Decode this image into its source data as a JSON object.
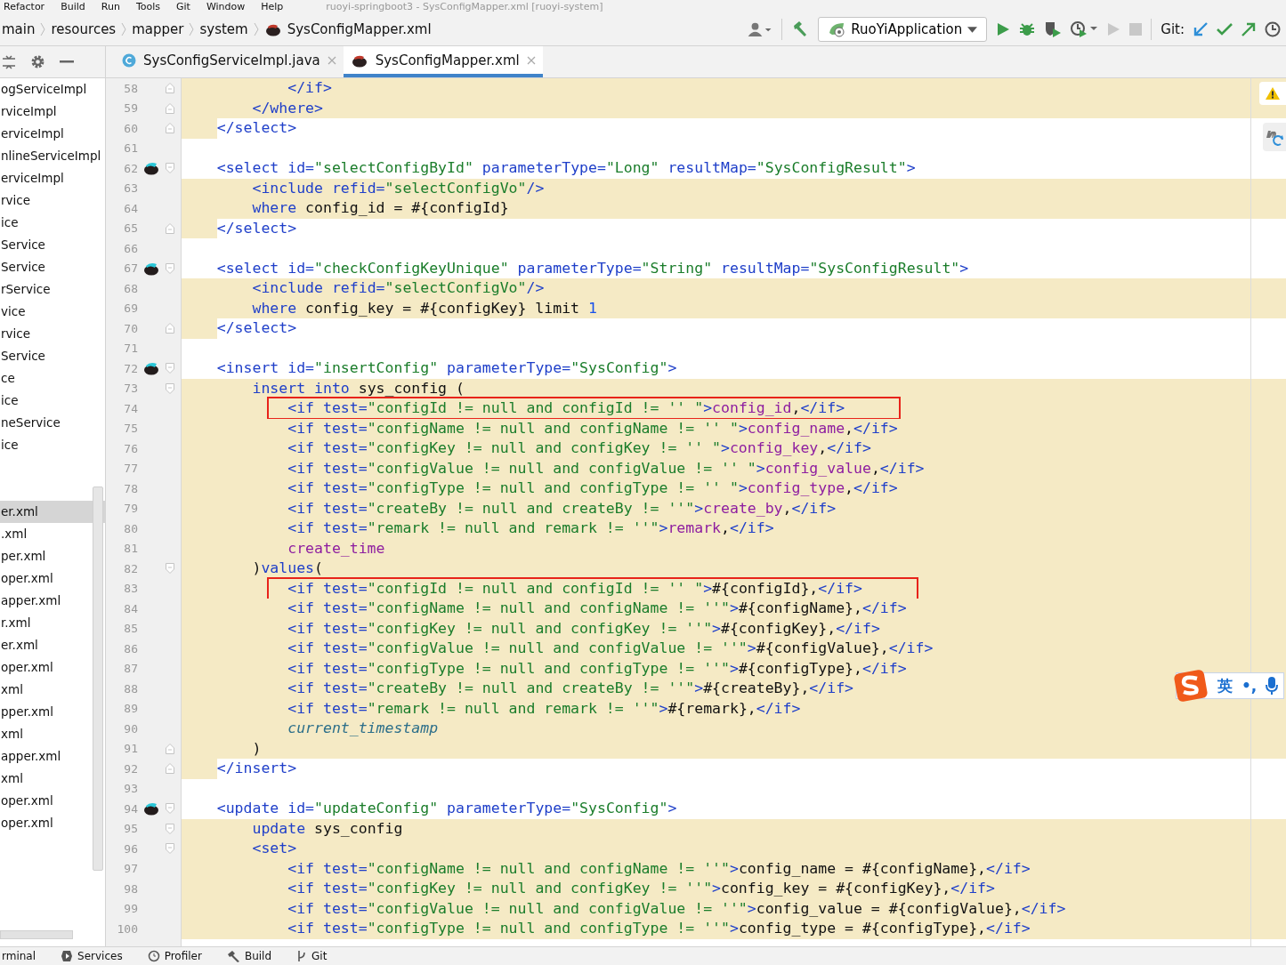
{
  "menu_bar": {
    "items": [
      "Refactor",
      "Build",
      "Run",
      "Tools",
      "Git",
      "Window",
      "Help"
    ],
    "title": "ruoyi-springboot3 - SysConfigMapper.xml [ruoyi-system]"
  },
  "breadcrumbs": [
    "main",
    "resources",
    "mapper",
    "system",
    "SysConfigMapper.xml"
  ],
  "toolbar": {
    "run_config": "RuoYiApplication",
    "git_label": "Git:"
  },
  "editor_tabs": [
    {
      "label": "SysConfigServiceImpl.java",
      "kind": "java",
      "selected": false
    },
    {
      "label": "SysConfigMapper.xml",
      "kind": "xml",
      "selected": true
    }
  ],
  "project_tree": {
    "items": [
      {
        "label": "ogServiceImpl",
        "selected": false
      },
      {
        "label": "rviceImpl",
        "selected": false
      },
      {
        "label": "erviceImpl",
        "selected": false
      },
      {
        "label": "nlineServiceImpl",
        "selected": false
      },
      {
        "label": "erviceImpl",
        "selected": false
      },
      {
        "label": "rvice",
        "selected": false
      },
      {
        "label": "ice",
        "selected": false
      },
      {
        "label": "Service",
        "selected": false
      },
      {
        "label": "Service",
        "selected": false
      },
      {
        "label": "rService",
        "selected": false
      },
      {
        "label": "vice",
        "selected": false
      },
      {
        "label": "rvice",
        "selected": false
      },
      {
        "label": "Service",
        "selected": false
      },
      {
        "label": "ce",
        "selected": false
      },
      {
        "label": "ice",
        "selected": false
      },
      {
        "label": "neService",
        "selected": false
      },
      {
        "label": "ice",
        "selected": false
      }
    ],
    "xml_items": [
      {
        "label": "er.xml",
        "selected": true
      },
      {
        "label": ".xml",
        "selected": false
      },
      {
        "label": "per.xml",
        "selected": false
      },
      {
        "label": "oper.xml",
        "selected": false
      },
      {
        "label": "apper.xml",
        "selected": false
      },
      {
        "label": "r.xml",
        "selected": false
      },
      {
        "label": "er.xml",
        "selected": false
      },
      {
        "label": "oper.xml",
        "selected": false
      },
      {
        "label": "xml",
        "selected": false
      },
      {
        "label": "pper.xml",
        "selected": false
      },
      {
        "label": "xml",
        "selected": false
      },
      {
        "label": "apper.xml",
        "selected": false
      },
      {
        "label": "xml",
        "selected": false
      },
      {
        "label": "oper.xml",
        "selected": false
      },
      {
        "label": "oper.xml",
        "selected": false
      }
    ]
  },
  "code_lines": [
    {
      "number": "58",
      "fold_end": true,
      "highlighted": true,
      "tokens": [
        {
          "kind": "tag",
          "text": "            </if>"
        }
      ]
    },
    {
      "number": "59",
      "fold_end": true,
      "highlighted": true,
      "tokens": [
        {
          "kind": "tag",
          "text": "        </where>"
        }
      ]
    },
    {
      "number": "60",
      "fold_end": true,
      "highlighted": false,
      "indent_highlighted": true,
      "tokens": [
        {
          "kind": "tag",
          "text": "    </select>"
        }
      ]
    },
    {
      "number": "61",
      "highlighted": false
    },
    {
      "number": "62",
      "fold_start": true,
      "bird": true,
      "highlighted": false,
      "tokens": [
        {
          "kind": "tag",
          "text": "    <select"
        },
        {
          "kind": "attr",
          "text": " id="
        },
        {
          "kind": "val",
          "text": "\"selectConfigById\""
        },
        {
          "kind": "attr",
          "text": " parameterType="
        },
        {
          "kind": "val",
          "text": "\"Long\""
        },
        {
          "kind": "attr",
          "text": " resultMap="
        },
        {
          "kind": "val",
          "text": "\"SysConfigResult\""
        },
        {
          "kind": "tag",
          "text": ">"
        }
      ]
    },
    {
      "number": "63",
      "highlighted": true,
      "tokens": [
        {
          "kind": "tag",
          "text": "        <include"
        },
        {
          "kind": "attr",
          "text": " refid="
        },
        {
          "kind": "val",
          "text": "\"selectConfigVo\""
        },
        {
          "kind": "tag",
          "text": "/>"
        }
      ]
    },
    {
      "number": "64",
      "highlighted": true,
      "tokens": [
        {
          "kind": "kw",
          "text": "        where"
        },
        {
          "kind": "plain",
          "text": " config_id = #{configId}"
        }
      ]
    },
    {
      "number": "65",
      "fold_end": true,
      "highlighted": false,
      "indent_highlighted": true,
      "tokens": [
        {
          "kind": "tag",
          "text": "    </select>"
        }
      ]
    },
    {
      "number": "66",
      "highlighted": false
    },
    {
      "number": "67",
      "fold_start": true,
      "bird": true,
      "highlighted": false,
      "tokens": [
        {
          "kind": "tag",
          "text": "    <select"
        },
        {
          "kind": "attr",
          "text": " id="
        },
        {
          "kind": "val",
          "text": "\"checkConfigKeyUnique\""
        },
        {
          "kind": "attr",
          "text": " parameterType="
        },
        {
          "kind": "val",
          "text": "\"String\""
        },
        {
          "kind": "attr",
          "text": " resultMap="
        },
        {
          "kind": "val",
          "text": "\"SysConfigResult\""
        },
        {
          "kind": "tag",
          "text": ">"
        }
      ]
    },
    {
      "number": "68",
      "highlighted": true,
      "tokens": [
        {
          "kind": "tag",
          "text": "        <include"
        },
        {
          "kind": "attr",
          "text": " refid="
        },
        {
          "kind": "val",
          "text": "\"selectConfigVo\""
        },
        {
          "kind": "tag",
          "text": "/>"
        }
      ]
    },
    {
      "number": "69",
      "highlighted": true,
      "tokens": [
        {
          "kind": "kw",
          "text": "        where"
        },
        {
          "kind": "plain",
          "text": " config_key = #{configKey} limit "
        },
        {
          "kind": "num",
          "text": "1"
        }
      ]
    },
    {
      "number": "70",
      "fold_end": true,
      "highlighted": false,
      "indent_highlighted": true,
      "tokens": [
        {
          "kind": "tag",
          "text": "    </select>"
        }
      ]
    },
    {
      "number": "71",
      "highlighted": false
    },
    {
      "number": "72",
      "fold_start": true,
      "bird": true,
      "highlighted": false,
      "tokens": [
        {
          "kind": "tag",
          "text": "    <insert"
        },
        {
          "kind": "attr",
          "text": " id="
        },
        {
          "kind": "val",
          "text": "\"insertConfig\""
        },
        {
          "kind": "attr",
          "text": " parameterType="
        },
        {
          "kind": "val",
          "text": "\"SysConfig\""
        },
        {
          "kind": "tag",
          "text": ">"
        }
      ]
    },
    {
      "number": "73",
      "fold_start": true,
      "highlighted": true,
      "tokens": [
        {
          "kind": "kw",
          "text": "        insert into"
        },
        {
          "kind": "plain",
          "text": " sys_config ("
        }
      ]
    },
    {
      "number": "74",
      "highlighted": true,
      "boxed": true,
      "tokens": [
        {
          "kind": "tag",
          "text": "            <if"
        },
        {
          "kind": "attr",
          "text": " test="
        },
        {
          "kind": "val",
          "text": "\"configId != null and configId != '' \""
        },
        {
          "kind": "tag",
          "text": ">"
        },
        {
          "kind": "field",
          "text": "config_id"
        },
        {
          "kind": "plain",
          "text": ","
        },
        {
          "kind": "tag",
          "text": "</if>"
        }
      ]
    },
    {
      "number": "75",
      "highlighted": true,
      "tokens": [
        {
          "kind": "tag",
          "text": "            <if"
        },
        {
          "kind": "attr",
          "text": " test="
        },
        {
          "kind": "val",
          "text": "\"configName != null and configName != '' \""
        },
        {
          "kind": "tag",
          "text": ">"
        },
        {
          "kind": "field",
          "text": "config_name"
        },
        {
          "kind": "plain",
          "text": ","
        },
        {
          "kind": "tag",
          "text": "</if>"
        }
      ]
    },
    {
      "number": "76",
      "highlighted": true,
      "tokens": [
        {
          "kind": "tag",
          "text": "            <if"
        },
        {
          "kind": "attr",
          "text": " test="
        },
        {
          "kind": "val",
          "text": "\"configKey != null and configKey != '' \""
        },
        {
          "kind": "tag",
          "text": ">"
        },
        {
          "kind": "field",
          "text": "config_key"
        },
        {
          "kind": "plain",
          "text": ","
        },
        {
          "kind": "tag",
          "text": "</if>"
        }
      ]
    },
    {
      "number": "77",
      "highlighted": true,
      "tokens": [
        {
          "kind": "tag",
          "text": "            <if"
        },
        {
          "kind": "attr",
          "text": " test="
        },
        {
          "kind": "val",
          "text": "\"configValue != null and configValue != '' \""
        },
        {
          "kind": "tag",
          "text": ">"
        },
        {
          "kind": "field",
          "text": "config_value"
        },
        {
          "kind": "plain",
          "text": ","
        },
        {
          "kind": "tag",
          "text": "</if>"
        }
      ]
    },
    {
      "number": "78",
      "highlighted": true,
      "tokens": [
        {
          "kind": "tag",
          "text": "            <if"
        },
        {
          "kind": "attr",
          "text": " test="
        },
        {
          "kind": "val",
          "text": "\"configType != null and configType != '' \""
        },
        {
          "kind": "tag",
          "text": ">"
        },
        {
          "kind": "field",
          "text": "config_type"
        },
        {
          "kind": "plain",
          "text": ","
        },
        {
          "kind": "tag",
          "text": "</if>"
        }
      ]
    },
    {
      "number": "79",
      "highlighted": true,
      "tokens": [
        {
          "kind": "tag",
          "text": "            <if"
        },
        {
          "kind": "attr",
          "text": " test="
        },
        {
          "kind": "val",
          "text": "\"createBy != null and createBy != ''\""
        },
        {
          "kind": "tag",
          "text": ">"
        },
        {
          "kind": "field",
          "text": "create_by"
        },
        {
          "kind": "plain",
          "text": ","
        },
        {
          "kind": "tag",
          "text": "</if>"
        }
      ]
    },
    {
      "number": "80",
      "highlighted": true,
      "tokens": [
        {
          "kind": "tag",
          "text": "            <if"
        },
        {
          "kind": "attr",
          "text": " test="
        },
        {
          "kind": "val",
          "text": "\"remark != null and remark != ''\""
        },
        {
          "kind": "tag",
          "text": ">"
        },
        {
          "kind": "field",
          "text": "remark"
        },
        {
          "kind": "plain",
          "text": ","
        },
        {
          "kind": "tag",
          "text": "</if>"
        }
      ]
    },
    {
      "number": "81",
      "highlighted": true,
      "tokens": [
        {
          "kind": "field",
          "text": "            create_time"
        }
      ]
    },
    {
      "number": "82",
      "fold_start": true,
      "highlighted": true,
      "tokens": [
        {
          "kind": "plain",
          "text": "        )"
        },
        {
          "kind": "kw",
          "text": "values"
        },
        {
          "kind": "plain",
          "text": "("
        }
      ]
    },
    {
      "number": "83",
      "highlighted": true,
      "boxed": true,
      "tokens": [
        {
          "kind": "tag",
          "text": "            <if"
        },
        {
          "kind": "attr",
          "text": " test="
        },
        {
          "kind": "val",
          "text": "\"configId != null and configId != '' \""
        },
        {
          "kind": "tag",
          "text": ">"
        },
        {
          "kind": "plain",
          "text": "#{configId},"
        },
        {
          "kind": "tag",
          "text": "</if>"
        }
      ]
    },
    {
      "number": "84",
      "highlighted": true,
      "tokens": [
        {
          "kind": "tag",
          "text": "            <if"
        },
        {
          "kind": "attr",
          "text": " test="
        },
        {
          "kind": "val",
          "text": "\"configName != null and configName != ''\""
        },
        {
          "kind": "tag",
          "text": ">"
        },
        {
          "kind": "plain",
          "text": "#{configName},"
        },
        {
          "kind": "tag",
          "text": "</if>"
        }
      ]
    },
    {
      "number": "85",
      "highlighted": true,
      "tokens": [
        {
          "kind": "tag",
          "text": "            <if"
        },
        {
          "kind": "attr",
          "text": " test="
        },
        {
          "kind": "val",
          "text": "\"configKey != null and configKey != ''\""
        },
        {
          "kind": "tag",
          "text": ">"
        },
        {
          "kind": "plain",
          "text": "#{configKey},"
        },
        {
          "kind": "tag",
          "text": "</if>"
        }
      ]
    },
    {
      "number": "86",
      "highlighted": true,
      "tokens": [
        {
          "kind": "tag",
          "text": "            <if"
        },
        {
          "kind": "attr",
          "text": " test="
        },
        {
          "kind": "val",
          "text": "\"configValue != null and configValue != ''\""
        },
        {
          "kind": "tag",
          "text": ">"
        },
        {
          "kind": "plain",
          "text": "#{configValue},"
        },
        {
          "kind": "tag",
          "text": "</if>"
        }
      ]
    },
    {
      "number": "87",
      "highlighted": true,
      "tokens": [
        {
          "kind": "tag",
          "text": "            <if"
        },
        {
          "kind": "attr",
          "text": " test="
        },
        {
          "kind": "val",
          "text": "\"configType != null and configType != ''\""
        },
        {
          "kind": "tag",
          "text": ">"
        },
        {
          "kind": "plain",
          "text": "#{configType},"
        },
        {
          "kind": "tag",
          "text": "</if>"
        }
      ]
    },
    {
      "number": "88",
      "highlighted": true,
      "tokens": [
        {
          "kind": "tag",
          "text": "            <if"
        },
        {
          "kind": "attr",
          "text": " test="
        },
        {
          "kind": "val",
          "text": "\"createBy != null and createBy != ''\""
        },
        {
          "kind": "tag",
          "text": ">"
        },
        {
          "kind": "plain",
          "text": "#{createBy},"
        },
        {
          "kind": "tag",
          "text": "</if>"
        }
      ]
    },
    {
      "number": "89",
      "highlighted": true,
      "tokens": [
        {
          "kind": "tag",
          "text": "            <if"
        },
        {
          "kind": "attr",
          "text": " test="
        },
        {
          "kind": "val",
          "text": "\"remark != null and remark != ''\""
        },
        {
          "kind": "tag",
          "text": ">"
        },
        {
          "kind": "plain",
          "text": "#{remark},"
        },
        {
          "kind": "tag",
          "text": "</if>"
        }
      ]
    },
    {
      "number": "90",
      "highlighted": true,
      "tokens": [
        {
          "kind": "func",
          "text": "            current_timestamp"
        }
      ]
    },
    {
      "number": "91",
      "fold_end": true,
      "highlighted": true,
      "tokens": [
        {
          "kind": "plain",
          "text": "        )"
        }
      ]
    },
    {
      "number": "92",
      "fold_end": true,
      "highlighted": false,
      "indent_highlighted": true,
      "tokens": [
        {
          "kind": "tag",
          "text": "    </insert>"
        }
      ]
    },
    {
      "number": "93",
      "highlighted": false
    },
    {
      "number": "94",
      "fold_start": true,
      "bird": true,
      "highlighted": false,
      "tokens": [
        {
          "kind": "tag",
          "text": "    <update"
        },
        {
          "kind": "attr",
          "text": " id="
        },
        {
          "kind": "val",
          "text": "\"updateConfig\""
        },
        {
          "kind": "attr",
          "text": " parameterType="
        },
        {
          "kind": "val",
          "text": "\"SysConfig\""
        },
        {
          "kind": "tag",
          "text": ">"
        }
      ]
    },
    {
      "number": "95",
      "fold_start": true,
      "highlighted": true,
      "tokens": [
        {
          "kind": "kw",
          "text": "        update"
        },
        {
          "kind": "plain",
          "text": " sys_config"
        }
      ]
    },
    {
      "number": "96",
      "fold_start": true,
      "highlighted": true,
      "tokens": [
        {
          "kind": "tag",
          "text": "        <set>"
        }
      ]
    },
    {
      "number": "97",
      "highlighted": true,
      "tokens": [
        {
          "kind": "tag",
          "text": "            <if"
        },
        {
          "kind": "attr",
          "text": " test="
        },
        {
          "kind": "val",
          "text": "\"configName != null and configName != ''\""
        },
        {
          "kind": "tag",
          "text": ">"
        },
        {
          "kind": "plain",
          "text": "config_name = #{configName},"
        },
        {
          "kind": "tag",
          "text": "</if>"
        }
      ]
    },
    {
      "number": "98",
      "highlighted": true,
      "tokens": [
        {
          "kind": "tag",
          "text": "            <if"
        },
        {
          "kind": "attr",
          "text": " test="
        },
        {
          "kind": "val",
          "text": "\"configKey != null and configKey != ''\""
        },
        {
          "kind": "tag",
          "text": ">"
        },
        {
          "kind": "plain",
          "text": "config_key = #{configKey},"
        },
        {
          "kind": "tag",
          "text": "</if>"
        }
      ]
    },
    {
      "number": "99",
      "highlighted": true,
      "tokens": [
        {
          "kind": "tag",
          "text": "            <if"
        },
        {
          "kind": "attr",
          "text": " test="
        },
        {
          "kind": "val",
          "text": "\"configValue != null and configValue != ''\""
        },
        {
          "kind": "tag",
          "text": ">"
        },
        {
          "kind": "plain",
          "text": "config_value = #{configValue},"
        },
        {
          "kind": "tag",
          "text": "</if>"
        }
      ]
    },
    {
      "number": "100",
      "highlighted": true,
      "tokens": [
        {
          "kind": "tag",
          "text": "            <if"
        },
        {
          "kind": "attr",
          "text": " test="
        },
        {
          "kind": "val",
          "text": "\"configType != null and configType != ''\""
        },
        {
          "kind": "tag",
          "text": ">"
        },
        {
          "kind": "plain",
          "text": "config_type = #{configType},"
        },
        {
          "kind": "tag",
          "text": "</if>"
        }
      ]
    }
  ],
  "ime_bar": {
    "mode": "英",
    "punct": "•,"
  },
  "tool_windows": [
    {
      "label": "rminal",
      "kind": "terminal"
    },
    {
      "label": "Services",
      "kind": "services"
    },
    {
      "label": "Profiler",
      "kind": "profiler"
    },
    {
      "label": "Build",
      "kind": "build"
    },
    {
      "label": "Git",
      "kind": "git"
    }
  ]
}
